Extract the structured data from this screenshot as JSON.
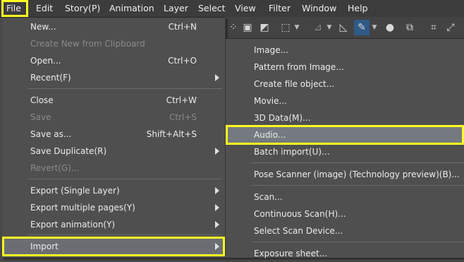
{
  "menubar": {
    "items": [
      "File",
      "Edit",
      "Story(P)",
      "Animation",
      "Layer",
      "Select",
      "View",
      "Filter",
      "Window",
      "Help"
    ]
  },
  "toolbar": {
    "icons": [
      "scatter-dots-icon",
      "figure-icon",
      "bucket-icon",
      "selection-grid-icon",
      "ruler-icon",
      "triangle-ruler-icon",
      "pen-icon",
      "dot-icon",
      "transform-icon",
      "crop-icon",
      "fit-icon"
    ]
  },
  "file_menu": {
    "items": [
      {
        "label": "New...",
        "shortcut": "Ctrl+N"
      },
      {
        "label": "Create New from Clipboard",
        "shortcut": ""
      },
      {
        "label": "Open...",
        "shortcut": "Ctrl+O"
      },
      {
        "label": "Recent(F)",
        "shortcut": ""
      },
      {
        "label": "Close",
        "shortcut": "Ctrl+W"
      },
      {
        "label": "Save",
        "shortcut": "Ctrl+S"
      },
      {
        "label": "Save as...",
        "shortcut": "Shift+Alt+S"
      },
      {
        "label": "Save Duplicate(R)",
        "shortcut": ""
      },
      {
        "label": "Revert(G)...",
        "shortcut": ""
      },
      {
        "label": "Export (Single Layer)",
        "shortcut": ""
      },
      {
        "label": "Export multiple pages(Y)",
        "shortcut": ""
      },
      {
        "label": "Export animation(Y)",
        "shortcut": ""
      },
      {
        "label": "Import",
        "shortcut": ""
      }
    ]
  },
  "import_menu": {
    "items": [
      {
        "label": "Image..."
      },
      {
        "label": "Pattern from Image..."
      },
      {
        "label": "Create file object..."
      },
      {
        "label": "Movie..."
      },
      {
        "label": "3D Data(M)..."
      },
      {
        "label": "Audio..."
      },
      {
        "label": "Batch import(U)..."
      },
      {
        "label": "Pose Scanner (image) (Technology preview)(B)..."
      },
      {
        "label": "Scan..."
      },
      {
        "label": "Continuous Scan(H)..."
      },
      {
        "label": "Select Scan Device..."
      },
      {
        "label": "Exposure sheet..."
      }
    ]
  },
  "colors": {
    "highlight": "#ffff22",
    "active_tool": "#2f5a86"
  }
}
